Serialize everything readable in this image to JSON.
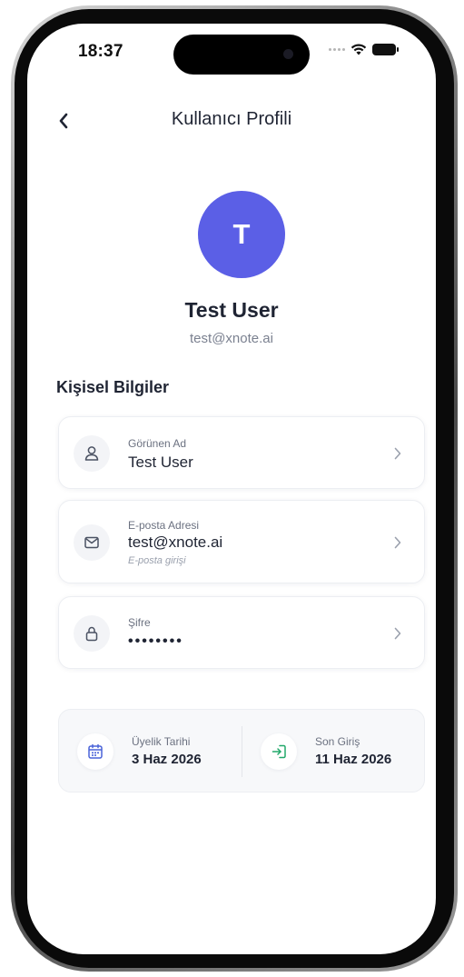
{
  "status_bar": {
    "time": "18:37"
  },
  "nav": {
    "title": "Kullanıcı Profili"
  },
  "profile": {
    "initial": "T",
    "name": "Test User",
    "email": "test@xnote.ai",
    "avatar_color": "#5b5fe6"
  },
  "section": {
    "title": "Kişisel Bilgiler"
  },
  "info_items": [
    {
      "label": "Görünen Ad",
      "value": "Test User",
      "icon": "user-icon"
    },
    {
      "label": "E-posta Adresi",
      "value": "test@xnote.ai",
      "note": "E-posta girişi",
      "icon": "mail-icon"
    },
    {
      "label": "Şifre",
      "value": "••••••••",
      "icon": "lock-icon"
    }
  ],
  "stats": {
    "membership": {
      "label": "Üyelik Tarihi",
      "value": "3 Haz 2026",
      "icon": "calendar-icon"
    },
    "last_login": {
      "label": "Son Giriş",
      "value": "11 Haz 2026",
      "icon": "login-icon"
    }
  },
  "colors": {
    "accent": "#5b5fe6",
    "login_icon": "#22a86a",
    "calendar_icon": "#4a63d8"
  }
}
